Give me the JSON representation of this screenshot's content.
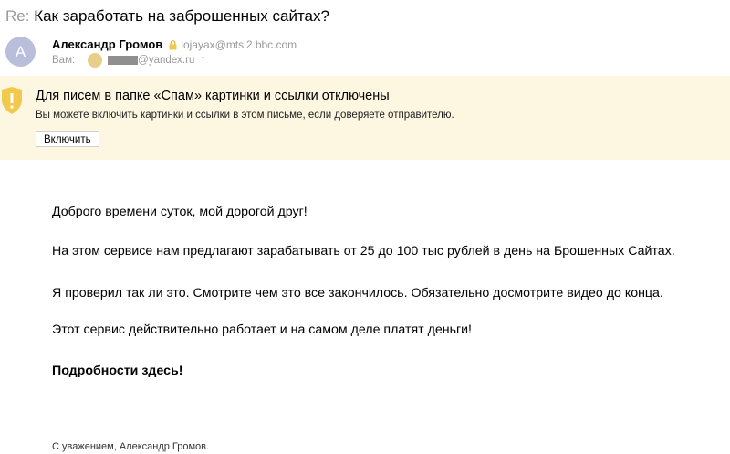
{
  "subject": {
    "prefix": "Re:",
    "text": "Как заработать на заброшенных сайтах?"
  },
  "sender": {
    "avatar_letter": "A",
    "name": "Александр Громов",
    "email": "lojayax@mtsi2.bbc.com",
    "to_label": "Вам:",
    "to_email": "@yandex.ru"
  },
  "spam_banner": {
    "title": "Для писем в папке «Спам» картинки и ссылки отключены",
    "subtitle": "Вы можете включить картинки и ссылки в этом письме, если доверяете отправителю.",
    "button": "Включить"
  },
  "body": {
    "p1": "Доброго времени суток, мой дорогой друг!",
    "p2": "На этом сервисе нам предлагают зарабатывать от 25 до 100 тыс рублей в день на Брошенных Сайтах.",
    "p3": "Я проверил так ли это. Смотрите чем это все закончилось. Обязательно досмотрите видео до конца.",
    "p4": "Этот сервис действительно работает и на самом деле платят деньги!",
    "p5": "Подробности здесь!"
  },
  "signature": "С уважением, Александр Громов.",
  "colors": {
    "banner_bg": "#fdf6e0",
    "shield": "#f2c94c",
    "avatar": "#b9bfdb"
  },
  "icons": {
    "badge": "lock-badge-icon",
    "shield": "shield-warning-icon",
    "chevron": "chevron-up-icon"
  }
}
